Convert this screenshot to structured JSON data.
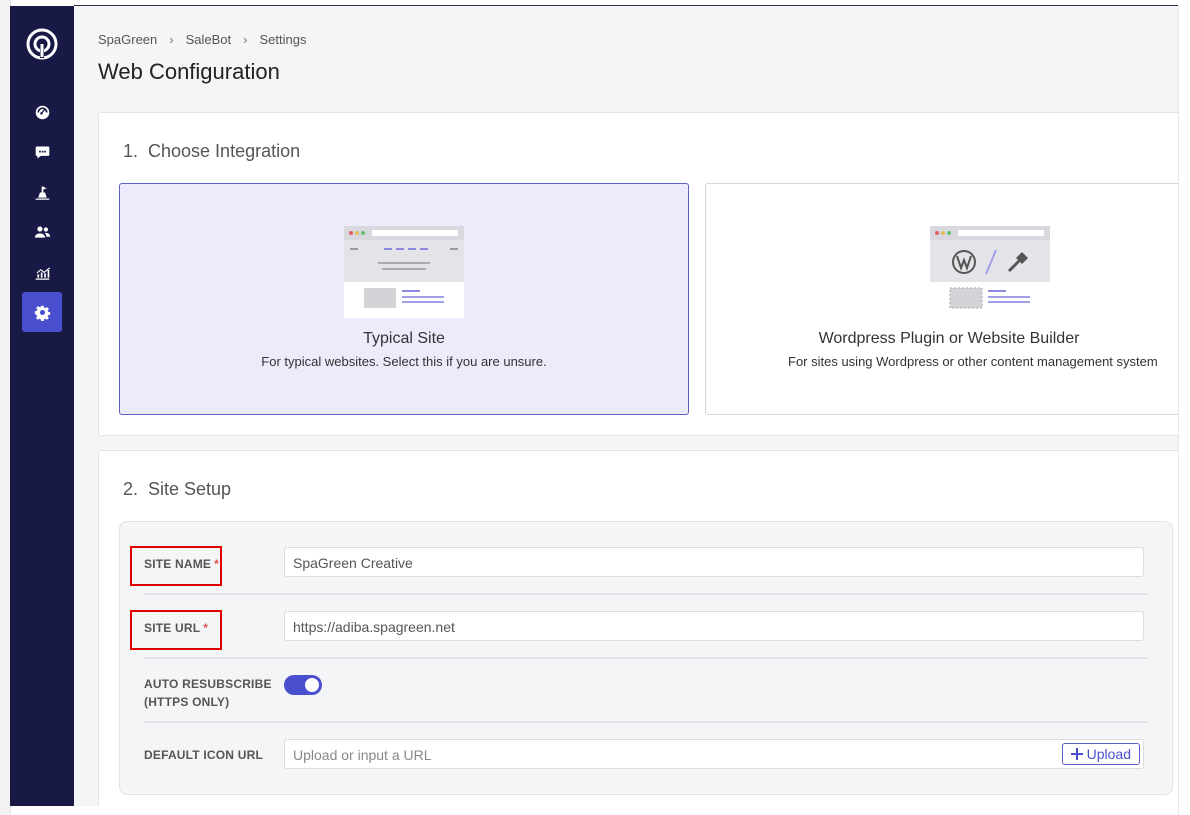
{
  "breadcrumb": [
    "SpaGreen",
    "SaleBot",
    "Settings"
  ],
  "breadcrumb_sep": "›",
  "page_title": "Web Configuration",
  "section1": {
    "title": "1.  Choose Integration",
    "options": [
      {
        "title": "Typical Site",
        "desc": "For typical websites. Select this if you are unsure.",
        "selected": true
      },
      {
        "title": "Wordpress Plugin or Website Builder",
        "desc": "For sites using Wordpress or other content management system",
        "selected": false
      }
    ]
  },
  "section2": {
    "title": "2.  Site Setup",
    "fields": {
      "site_name_label": "SITE NAME",
      "site_name_value": "SpaGreen Creative",
      "site_url_label": "SITE URL",
      "site_url_value": "https://adiba.spagreen.net",
      "auto_resub_label_1": "AUTO RESUBSCRIBE",
      "auto_resub_label_2": "(HTTPS ONLY)",
      "auto_resub_on": true,
      "icon_url_label": "DEFAULT ICON URL",
      "icon_url_placeholder": "Upload or input a URL",
      "upload_label": "Upload",
      "required_mark": "*"
    }
  },
  "sidebar": {
    "items": [
      "dashboard-icon",
      "chat-icon",
      "campaign-icon",
      "users-icon",
      "analytics-icon",
      "settings-icon"
    ],
    "active": "settings-icon"
  },
  "colors": {
    "sidebar": "#181a45",
    "accent": "#4a4fd0",
    "selected_bg": "#ecebfb",
    "highlight": "#e00000"
  }
}
